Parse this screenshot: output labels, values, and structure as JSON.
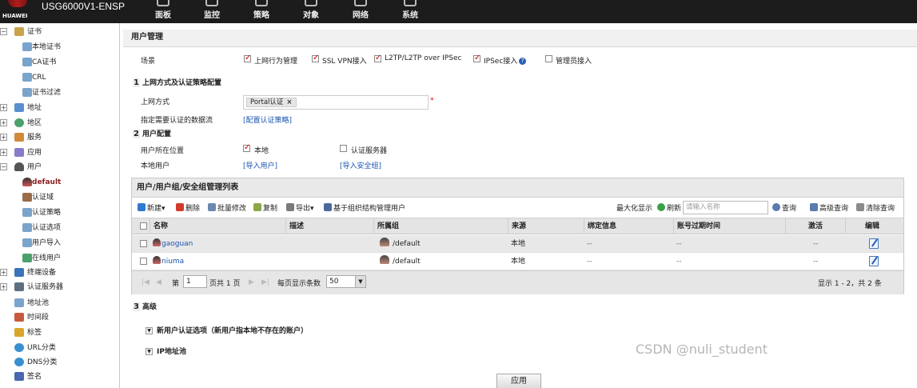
{
  "header": {
    "brand": "HUAWEI",
    "device": "USG6000V1-ENSP",
    "nav": [
      {
        "label": "面板",
        "icon": "dashboard-icon"
      },
      {
        "label": "监控",
        "icon": "monitor-icon"
      },
      {
        "label": "策略",
        "icon": "policy-icon"
      },
      {
        "label": "对象",
        "icon": "object-icon",
        "active": true
      },
      {
        "label": "网络",
        "icon": "network-icon"
      },
      {
        "label": "系统",
        "icon": "system-icon"
      }
    ]
  },
  "sidebar": {
    "items": [
      {
        "label": "证书",
        "level": 0,
        "expanded": true
      },
      {
        "label": "本地证书",
        "level": 1
      },
      {
        "label": "CA证书",
        "level": 1
      },
      {
        "label": "CRL",
        "level": 1
      },
      {
        "label": "证书过滤",
        "level": 1
      },
      {
        "label": "地址",
        "level": 0
      },
      {
        "label": "地区",
        "level": 0
      },
      {
        "label": "服务",
        "level": 0
      },
      {
        "label": "应用",
        "level": 0
      },
      {
        "label": "用户",
        "level": 0,
        "expanded": true
      },
      {
        "label": "default",
        "level": 1,
        "selected": true
      },
      {
        "label": "认证域",
        "level": 1
      },
      {
        "label": "认证策略",
        "level": 1
      },
      {
        "label": "认证选项",
        "level": 1
      },
      {
        "label": "用户导入",
        "level": 1
      },
      {
        "label": "在线用户",
        "level": 1
      },
      {
        "label": "终端设备",
        "level": 0
      },
      {
        "label": "认证服务器",
        "level": 0
      },
      {
        "label": "地址池",
        "level": 0,
        "leaf": true
      },
      {
        "label": "时间段",
        "level": 0,
        "leaf": true
      },
      {
        "label": "标签",
        "level": 0,
        "leaf": true
      },
      {
        "label": "URL分类",
        "level": 0,
        "leaf": true
      },
      {
        "label": "DNS分类",
        "level": 0,
        "leaf": true
      },
      {
        "label": "签名",
        "level": 0,
        "leaf": true
      }
    ]
  },
  "main": {
    "title": "用户管理",
    "scene": {
      "label": "场景",
      "options": [
        {
          "label": "上网行为管理",
          "checked": true
        },
        {
          "label": "SSL VPN接入",
          "checked": true
        },
        {
          "label": "L2TP/L2TP over IPSec",
          "checked": true
        },
        {
          "label": "IPSec接入",
          "checked": true
        },
        {
          "label": "管理员接入",
          "checked": false
        }
      ]
    },
    "sec1": {
      "num": "1",
      "title": "上网方式及认证策略配置",
      "access_label": "上网方式",
      "access_tag": "Portal认证",
      "required_mark": "*",
      "flow_label": "指定需要认证的数据流",
      "flow_link": "[配置认证策略]"
    },
    "sec2": {
      "num": "2",
      "title": "用户配置",
      "location_label": "用户所在位置",
      "loc_local": "本地",
      "loc_server": "认证服务器",
      "local_user_label": "本地用户",
      "import_user": "[导入用户]",
      "import_group": "[导入安全组]"
    },
    "list": {
      "title": "用户/用户组/安全组管理列表",
      "toolbar": {
        "new": "新建",
        "delete": "删除",
        "batch": "批量修改",
        "copy": "复制",
        "export": "导出",
        "org": "基于组织结构管理用户",
        "maximize": "最大化显示",
        "refresh": "刷新",
        "search_placeholder": "请输入名称",
        "query": "查询",
        "advanced": "高级查询",
        "clear": "清除查询"
      },
      "columns": [
        "名称",
        "描述",
        "所属组",
        "来源",
        "绑定信息",
        "账号过期时间",
        "激活",
        "编辑"
      ],
      "rows": [
        {
          "name": "gaoguan",
          "desc": "",
          "group": "/default",
          "source": "本地",
          "bind": "--",
          "expire": "--",
          "active": "--"
        },
        {
          "name": "niuma",
          "desc": "",
          "group": "/default",
          "source": "本地",
          "bind": "--",
          "expire": "--",
          "active": "--"
        }
      ],
      "pager": {
        "page_prefix": "第",
        "page": "1",
        "page_suffix": "页共 1 页",
        "per_page_label": "每页显示条数",
        "per_page": "50",
        "summary": "显示 1 - 2，共 2 条"
      }
    },
    "sec3": {
      "num": "3",
      "title": "高级",
      "opt1": "新用户认证选项（新用户指本地不存在的账户）",
      "opt2": "IP地址池"
    },
    "apply": "应用"
  },
  "watermark": "CSDN @nuli_student"
}
